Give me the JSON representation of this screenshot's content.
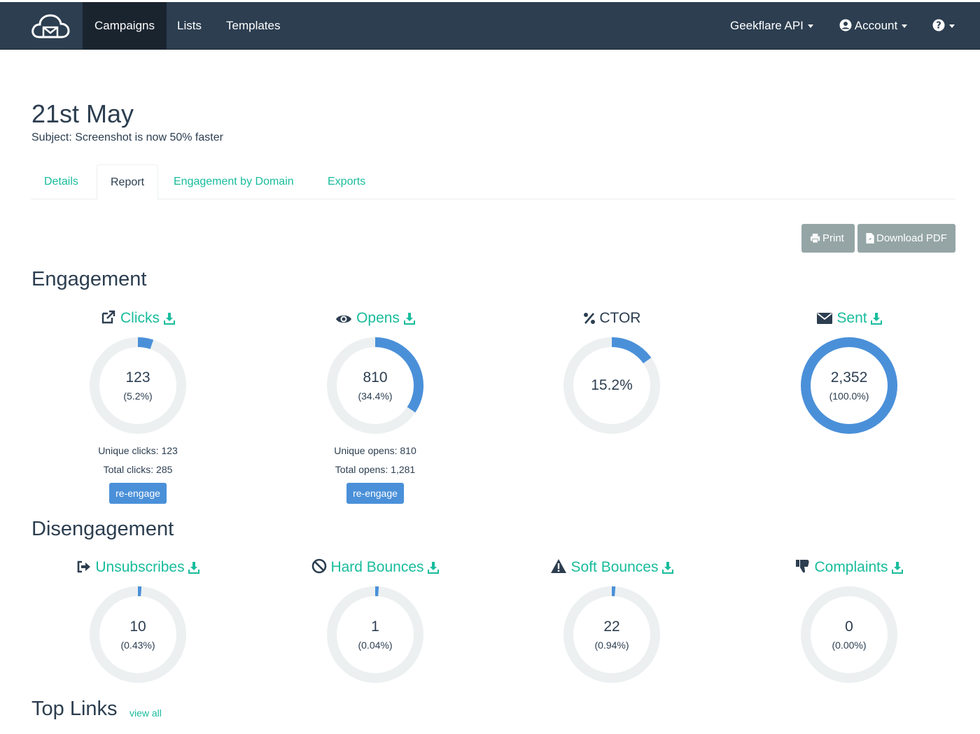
{
  "nav": {
    "items": [
      "Campaigns",
      "Lists",
      "Templates"
    ],
    "api": "Geekflare API",
    "account": "Account",
    "help_icon": "question-circle-icon"
  },
  "campaign": {
    "title": "21st May",
    "subject": "Subject: Screenshot is now 50% faster"
  },
  "tabs": [
    "Details",
    "Report",
    "Engagement by Domain",
    "Exports"
  ],
  "actions": {
    "print": "Print",
    "download_pdf": "Download PDF"
  },
  "engagement": {
    "title": "Engagement",
    "clicks": {
      "label": "Clicks",
      "value": "123",
      "pct": "(5.2%)",
      "fraction": 0.052,
      "unique": "Unique clicks: 123",
      "total": "Total clicks: 285",
      "button": "re-engage"
    },
    "opens": {
      "label": "Opens",
      "value": "810",
      "pct": "(34.4%)",
      "fraction": 0.344,
      "unique": "Unique opens: 810",
      "total": "Total opens: 1,281",
      "button": "re-engage"
    },
    "ctor": {
      "label": "CTOR",
      "value": "15.2%",
      "fraction": 0.152
    },
    "sent": {
      "label": "Sent",
      "value": "2,352",
      "pct": "(100.0%)",
      "fraction": 1.0
    }
  },
  "disengagement": {
    "title": "Disengagement",
    "unsubscribes": {
      "label": "Unsubscribes",
      "value": "10",
      "pct": "(0.43%)",
      "fraction": 0.0043
    },
    "hard_bounces": {
      "label": "Hard Bounces",
      "value": "1",
      "pct": "(0.04%)",
      "fraction": 0.0004
    },
    "soft_bounces": {
      "label": "Soft Bounces",
      "value": "22",
      "pct": "(0.94%)",
      "fraction": 0.0094
    },
    "complaints": {
      "label": "Complaints",
      "value": "0",
      "pct": "(0.00%)",
      "fraction": 0.0
    }
  },
  "top_links": {
    "title": "Top Links",
    "view_all": "view all"
  },
  "colors": {
    "navbar": "#2c3e50",
    "accent": "#18bc9c",
    "donut_fill": "#4a90d9",
    "donut_track": "#ecf0f1",
    "button_gray": "#95a5a6"
  }
}
